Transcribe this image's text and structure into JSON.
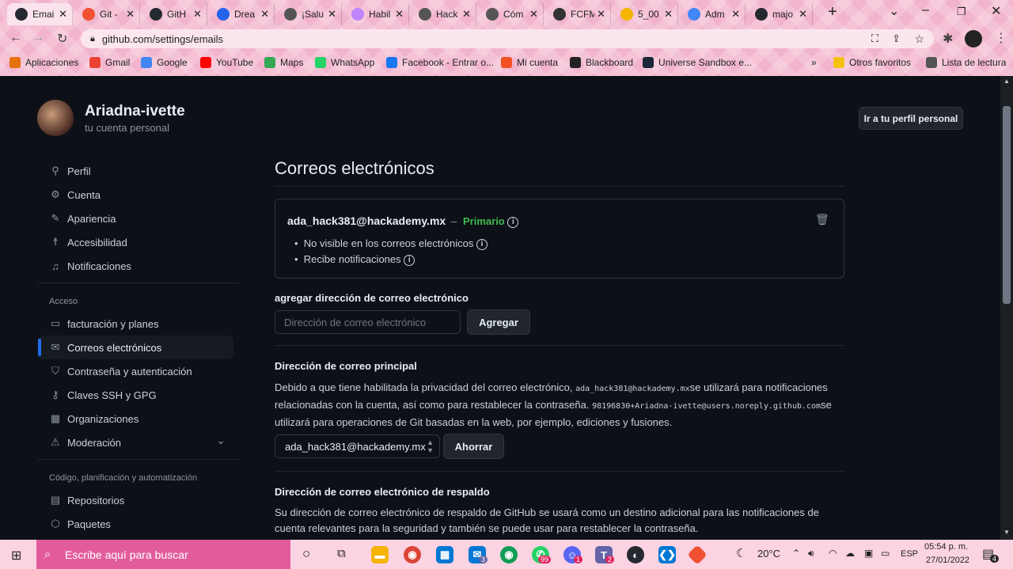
{
  "browser": {
    "tabs": [
      {
        "label": "Emai",
        "icon": "github-icon",
        "color": "#24292f",
        "active": true
      },
      {
        "label": "Git -",
        "icon": "git-icon",
        "color": "#f05133"
      },
      {
        "label": "GitH",
        "icon": "github-icon",
        "color": "#24292f"
      },
      {
        "label": "Drea",
        "icon": "circle-icon",
        "color": "#2563eb"
      },
      {
        "label": "¡Salu",
        "icon": "globe-icon",
        "color": "#555"
      },
      {
        "label": "Habil",
        "icon": "heart-icon",
        "color": "#c084fc"
      },
      {
        "label": "Hack",
        "icon": "globe-icon",
        "color": "#555"
      },
      {
        "label": "Cóm",
        "icon": "globe-icon",
        "color": "#555"
      },
      {
        "label": "FCFM",
        "icon": "fcfm-icon",
        "color": "#333"
      },
      {
        "label": "5_00",
        "icon": "drive-icon",
        "color": "#f4b400"
      },
      {
        "label": "Adm",
        "icon": "docs-icon",
        "color": "#4285f4"
      },
      {
        "label": "majo",
        "icon": "github-icon",
        "color": "#24292f"
      }
    ],
    "url": "github.com/settings/emails",
    "bookmarks": [
      {
        "label": "Aplicaciones",
        "color": "#e8710a"
      },
      {
        "label": "Gmail",
        "color": "#ea4335"
      },
      {
        "label": "Google",
        "color": "#4285f4"
      },
      {
        "label": "YouTube",
        "color": "#ff0000"
      },
      {
        "label": "Maps",
        "color": "#34a853"
      },
      {
        "label": "WhatsApp",
        "color": "#25d366"
      },
      {
        "label": "Facebook - Entrar o...",
        "color": "#1877f2"
      },
      {
        "label": "Mi cuenta",
        "color": "#f25022"
      },
      {
        "label": "Blackboard",
        "color": "#222"
      },
      {
        "label": "Universe Sandbox e...",
        "color": "#1b2838"
      },
      {
        "label": "Otros favoritos",
        "color": "#f4c20d"
      },
      {
        "label": "Lista de lectura",
        "color": "#555"
      }
    ],
    "overflow": "»"
  },
  "user": {
    "name": "Ariadna-ivette",
    "subtitle": "tu cuenta personal",
    "profile_button": "Ir a tu perfil personal"
  },
  "sidebar": {
    "items_top": [
      {
        "label": "Perfil",
        "icon": "person-icon",
        "glyph": "⚲"
      },
      {
        "label": "Cuenta",
        "icon": "gear-icon",
        "glyph": "⚙"
      },
      {
        "label": "Apariencia",
        "icon": "paintbrush-icon",
        "glyph": "✎"
      },
      {
        "label": "Accesibilidad",
        "icon": "accessibility-icon",
        "glyph": "☨"
      },
      {
        "label": "Notificaciones",
        "icon": "bell-icon",
        "glyph": "♫"
      }
    ],
    "group_access": "Acceso",
    "items_access": [
      {
        "label": "facturación y planes",
        "icon": "credit-card-icon",
        "glyph": "▭"
      },
      {
        "label": "Correos electrónicos",
        "icon": "mail-icon",
        "glyph": "✉",
        "selected": true
      },
      {
        "label": "Contraseña y autenticación",
        "icon": "shield-icon",
        "glyph": "⛉"
      },
      {
        "label": "Claves SSH y GPG",
        "icon": "key-icon",
        "glyph": "⚷"
      },
      {
        "label": "Organizaciones",
        "icon": "organization-icon",
        "glyph": "▦"
      },
      {
        "label": "Moderación",
        "icon": "report-icon",
        "glyph": "⚠"
      }
    ],
    "group_code": "Código, planificación y automatización",
    "items_code": [
      {
        "label": "Repositorios",
        "icon": "repo-icon",
        "glyph": "▤"
      },
      {
        "label": "Paquetes",
        "icon": "package-icon",
        "glyph": "⬡"
      }
    ]
  },
  "main": {
    "title": "Correos electrónicos",
    "email": {
      "address": "ada_hack381@hackademy.mx",
      "dash": "–",
      "primary": "Primario",
      "bullets": [
        "No visible en los correos electrónicos",
        "Recibe notificaciones"
      ]
    },
    "add": {
      "label": "agregar dirección de correo electrónico",
      "placeholder": "Dirección de correo electrónico",
      "button": "Agregar"
    },
    "principal": {
      "heading": "Dirección de correo principal",
      "text1": "Debido a que tiene habilitada la privacidad del correo electrónico, ",
      "mono1": "ada_hack381@hackademy.mx",
      "text2": "se utilizará para notificaciones relacionadas con la cuenta, así como para restablecer la contraseña. ",
      "mono2": "98196830+Ariadna-ivette@users.noreply.github.com",
      "text3": "se utilizará para operaciones de Git basadas en la web, por ejemplo, ediciones y fusiones.",
      "select_value": "ada_hack381@hackademy.mx",
      "button": "Ahorrar"
    },
    "backup": {
      "heading": "Dirección de correo electrónico de respaldo",
      "text": "Su dirección de correo electrónico de respaldo de GitHub se usará como un destino adicional para las notificaciones de cuenta relevantes para la seguridad y también se puede usar para restablecer la contraseña."
    }
  },
  "taskbar": {
    "search_placeholder": "Escribe aquí para buscar",
    "weather": "20°C",
    "language": "ESP",
    "time": "05:54 p. m.",
    "date": "27/01/2022",
    "badges": {
      "mail": "3",
      "whatsapp": "99",
      "discord": "1",
      "teams": "2",
      "notifications": "4"
    }
  }
}
